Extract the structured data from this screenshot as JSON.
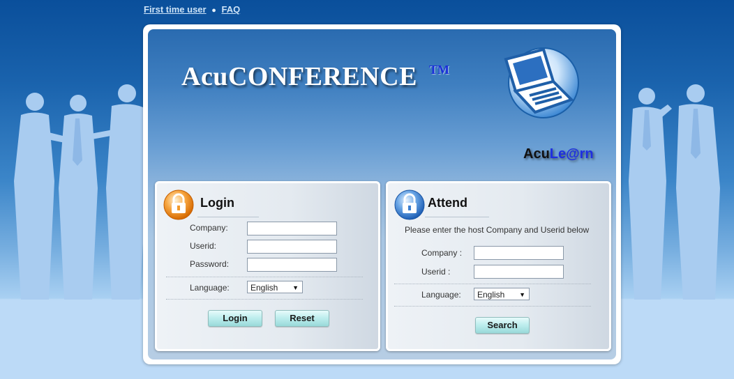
{
  "topnav": {
    "first_time_user": "First time user",
    "faq": "FAQ"
  },
  "header": {
    "title": "AcuCONFERENCE",
    "trademark": "TM",
    "brand_part1": "Acu",
    "brand_part2": "Le@rn"
  },
  "login": {
    "title": "Login",
    "company_label": "Company:",
    "userid_label": "Userid:",
    "password_label": "Password:",
    "language_label": "Language:",
    "company_value": "",
    "userid_value": "",
    "password_value": "",
    "language_value": "English",
    "login_button": "Login",
    "reset_button": "Reset"
  },
  "attend": {
    "title": "Attend",
    "hint": "Please enter the host Company and Userid below",
    "company_label": "Company :",
    "userid_label": "Userid :",
    "language_label": "Language:",
    "company_value": "",
    "userid_value": "",
    "language_value": "English",
    "search_button": "Search"
  },
  "colors": {
    "background_top": "#0a4f9b",
    "background_bottom": "#bcdaf7",
    "button": "#bfeeee",
    "trademark": "#1a2fd9"
  },
  "icons": [
    "lock-icon",
    "laptop-icon",
    "dropdown-arrow-icon"
  ]
}
